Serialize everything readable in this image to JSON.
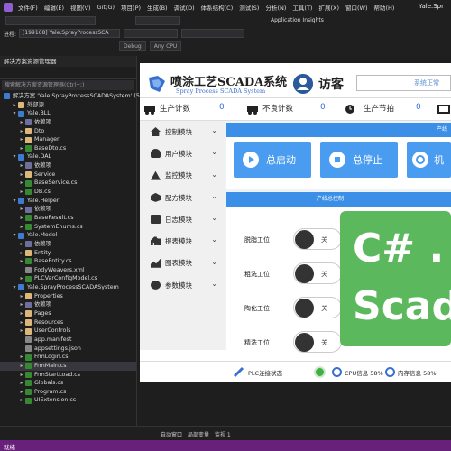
{
  "menu": {
    "items": [
      "文件(F)",
      "编辑(E)",
      "视图(V)",
      "Git(G)",
      "项目(P)",
      "生成(B)",
      "调试(D)",
      "体系结构(C)",
      "测试(S)",
      "分析(N)",
      "工具(T)",
      "扩展(X)",
      "窗口(W)",
      "帮助(H)"
    ],
    "window_title": "Yale.Spr"
  },
  "toolbar": {
    "insights": "Application Insights",
    "process_label": "进程:",
    "process_value": "[199168] Yale.SprayProcessSCA",
    "debug_config": "Debug",
    "platform": "Any CPU"
  },
  "solution_explorer": {
    "title": "解决方案资源管理器",
    "search_placeholder": "搜索解决方案资源管理器(Ctrl+;)",
    "items": [
      {
        "label": "解决方案 'Yale.SprayProcessSCADASystem' (5 个",
        "indent": 0,
        "icon": "solution-icon",
        "arrow": ""
      },
      {
        "label": "外部源",
        "indent": 1,
        "icon": "folder-icon",
        "arrow": "▸"
      },
      {
        "label": "Yale.BLL",
        "indent": 1,
        "icon": "project-icon",
        "arrow": "▾"
      },
      {
        "label": "依赖项",
        "indent": 2,
        "icon": "dependency-icon",
        "arrow": "▸"
      },
      {
        "label": "Dto",
        "indent": 2,
        "icon": "folder-icon",
        "arrow": "▸"
      },
      {
        "label": "Manager",
        "indent": 2,
        "icon": "folder-icon",
        "arrow": "▸"
      },
      {
        "label": "BaseDto.cs",
        "indent": 2,
        "icon": "cs-icon",
        "arrow": "▸"
      },
      {
        "label": "Yale.DAL",
        "indent": 1,
        "icon": "project-icon",
        "arrow": "▾"
      },
      {
        "label": "依赖项",
        "indent": 2,
        "icon": "dependency-icon",
        "arrow": "▸"
      },
      {
        "label": "Service",
        "indent": 2,
        "icon": "folder-icon",
        "arrow": "▸"
      },
      {
        "label": "BaseService.cs",
        "indent": 2,
        "icon": "cs-icon",
        "arrow": "▸"
      },
      {
        "label": "DB.cs",
        "indent": 2,
        "icon": "cs-icon",
        "arrow": "▸"
      },
      {
        "label": "Yale.Helper",
        "indent": 1,
        "icon": "project-icon",
        "arrow": "▾"
      },
      {
        "label": "依赖项",
        "indent": 2,
        "icon": "dependency-icon",
        "arrow": "▸"
      },
      {
        "label": "BaseResult.cs",
        "indent": 2,
        "icon": "cs-icon",
        "arrow": "▸"
      },
      {
        "label": "SystemEnums.cs",
        "indent": 2,
        "icon": "cs-icon",
        "arrow": "▸"
      },
      {
        "label": "Yale.Model",
        "indent": 1,
        "icon": "project-icon",
        "arrow": "▾"
      },
      {
        "label": "依赖项",
        "indent": 2,
        "icon": "dependency-icon",
        "arrow": "▸"
      },
      {
        "label": "Entity",
        "indent": 2,
        "icon": "folder-icon",
        "arrow": "▸"
      },
      {
        "label": "BaseEntity.cs",
        "indent": 2,
        "icon": "cs-icon",
        "arrow": "▸"
      },
      {
        "label": "FodyWeavers.xml",
        "indent": 2,
        "icon": "file-icon",
        "arrow": ""
      },
      {
        "label": "PLCVarConfigModel.cs",
        "indent": 2,
        "icon": "cs-icon",
        "arrow": "▸"
      },
      {
        "label": "Yale.SprayProcessSCADASystem",
        "indent": 1,
        "icon": "project-icon",
        "arrow": "▾"
      },
      {
        "label": "Properties",
        "indent": 2,
        "icon": "folder-icon",
        "arrow": "▸"
      },
      {
        "label": "依赖项",
        "indent": 2,
        "icon": "dependency-icon",
        "arrow": "▸"
      },
      {
        "label": "Pages",
        "indent": 2,
        "icon": "folder-icon",
        "arrow": "▸"
      },
      {
        "label": "Resources",
        "indent": 2,
        "icon": "folder-icon",
        "arrow": "▸"
      },
      {
        "label": "UserControls",
        "indent": 2,
        "icon": "folder-icon",
        "arrow": "▸"
      },
      {
        "label": "app.manifest",
        "indent": 2,
        "icon": "file-icon",
        "arrow": ""
      },
      {
        "label": "appsettings.json",
        "indent": 2,
        "icon": "file-icon",
        "arrow": ""
      },
      {
        "label": "FrmLogin.cs",
        "indent": 2,
        "icon": "cs-icon",
        "arrow": "▸"
      },
      {
        "label": "FrmMain.cs",
        "indent": 2,
        "icon": "cs-icon",
        "arrow": "▸"
      },
      {
        "label": "FrmStartLoad.cs",
        "indent": 2,
        "icon": "cs-icon",
        "arrow": "▸"
      },
      {
        "label": "Globals.cs",
        "indent": 2,
        "icon": "cs-icon",
        "arrow": "▸"
      },
      {
        "label": "Program.cs",
        "indent": 2,
        "icon": "cs-icon",
        "arrow": "▸"
      },
      {
        "label": "UIExtension.cs",
        "indent": 2,
        "icon": "cs-icon",
        "arrow": "▸"
      }
    ]
  },
  "bottom_tabs": [
    "自动窗口",
    "局部变量",
    "监视 1"
  ],
  "status_bar": "就绪",
  "scada": {
    "title": "喷涂工艺SCADA系统",
    "subtitle": "Spray Process SCADA System",
    "user": "访客",
    "system_status": "系统正常",
    "counters": [
      {
        "label": "生产计数",
        "value": "0"
      },
      {
        "label": "不良计数",
        "value": "0"
      },
      {
        "label": "生产节拍",
        "value": "0"
      }
    ],
    "nav": [
      "控制模块",
      "用户模块",
      "监控模块",
      "配方模块",
      "日志模块",
      "报表模块",
      "图表模块",
      "参数模块"
    ],
    "panel1_header": "产线",
    "buttons": [
      "总启动",
      "总停止",
      "机"
    ],
    "panel2_header": "产线总控制",
    "switches": [
      {
        "label": "脱脂工位",
        "state": "关"
      },
      {
        "label": "粗洗工位",
        "state": "关"
      },
      {
        "label": "陶化工位",
        "state": "关"
      },
      {
        "label": "精洗工位",
        "state": "关"
      }
    ],
    "badge_line1": "C# .",
    "badge_line2": "Scad",
    "footer": {
      "plc_label": "PLC连接状态",
      "cpu": "CPU信息 58%",
      "memory": "内存信息 58%"
    },
    "colors": {
      "accent": "#3b8fe6",
      "led": "#3cb043",
      "badge": "#5cb85c"
    }
  }
}
